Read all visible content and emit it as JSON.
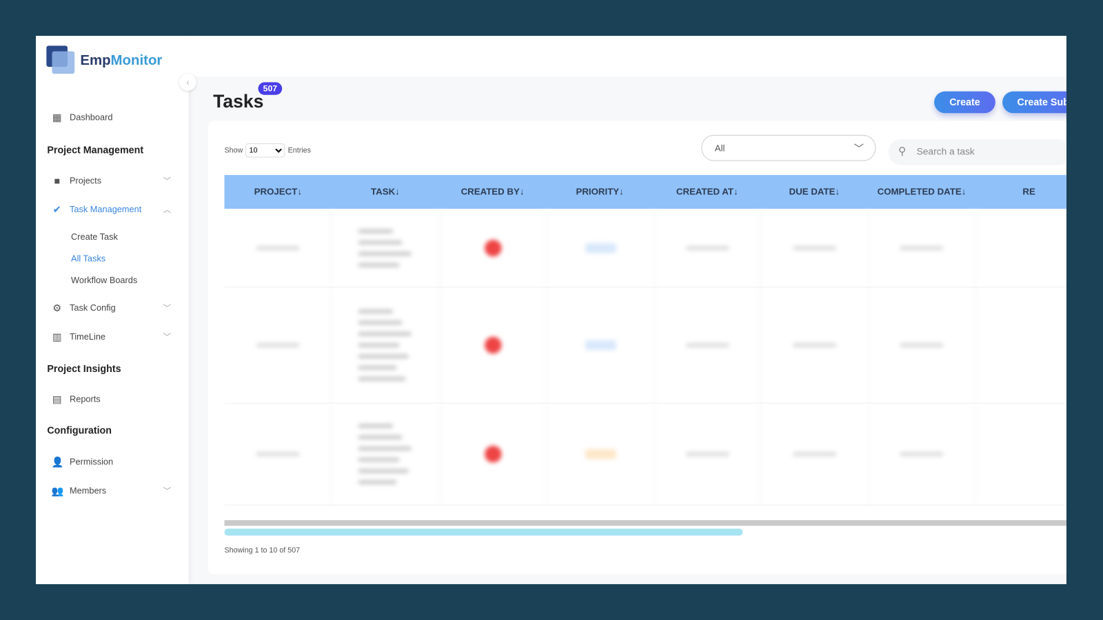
{
  "brand": {
    "name_part1": "Emp",
    "name_part2": "Monitor"
  },
  "sidebar": {
    "dashboard": "Dashboard",
    "sections": [
      "Project Management",
      "Project Insights",
      "Configuration"
    ],
    "projects": "Projects",
    "task_management": "Task Management",
    "sub_items": [
      "Create Task",
      "All Tasks",
      "Workflow Boards"
    ],
    "task_config": "Task Config",
    "timeline": "TimeLine",
    "reports": "Reports",
    "permission": "Permission",
    "members": "Members"
  },
  "header": {
    "title": "Tasks",
    "count": "507",
    "create": "Create",
    "create_sub": "Create Sub"
  },
  "controls": {
    "show": "Show",
    "entries_value": "10",
    "entries": "Entries",
    "filter_value": "All",
    "search_placeholder": "Search a task"
  },
  "table": {
    "columns": [
      "PROJECT↓",
      "TASK↓",
      "CREATED BY↓",
      "PRIORITY↓",
      "CREATED AT↓",
      "DUE DATE↓",
      "COMPLETED DATE↓",
      "RE"
    ]
  },
  "colors": {
    "accent": "#3a86e0",
    "header_bg": "#90c2f9",
    "badge": "#4a3ee8"
  },
  "footer": {
    "showing": "Showing 1 to 10 of 507"
  }
}
